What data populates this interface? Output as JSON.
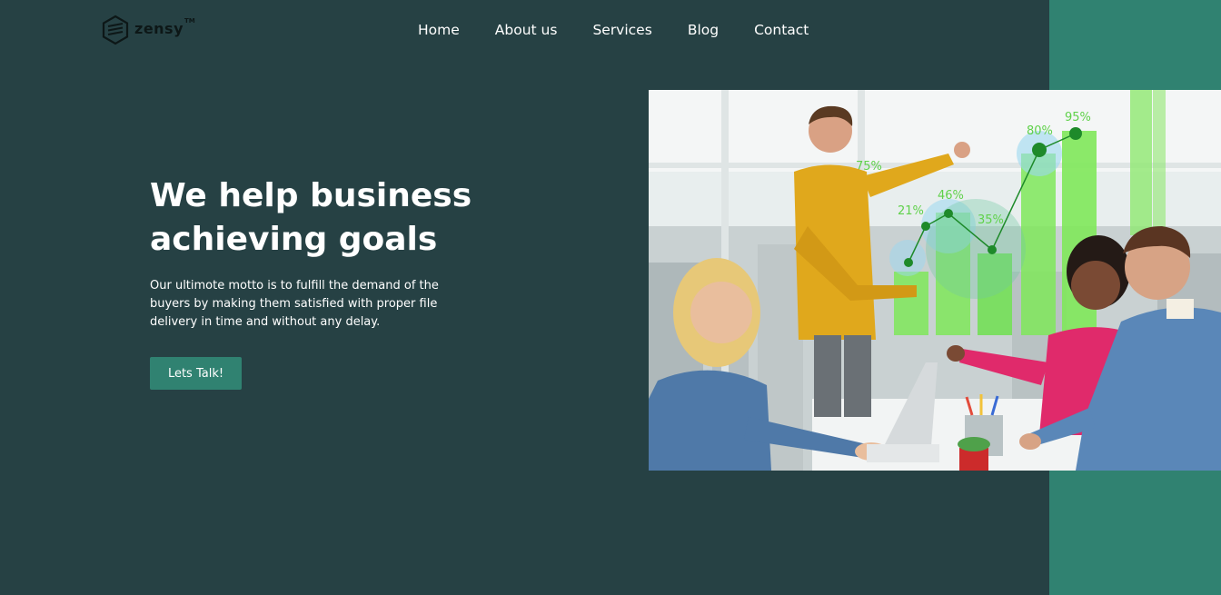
{
  "brand": {
    "name": "zensy",
    "trademark": "TM",
    "icon": "cube-logo-icon"
  },
  "nav": {
    "items": [
      {
        "label": "Home"
      },
      {
        "label": "About us"
      },
      {
        "label": "Services"
      },
      {
        "label": "Blog"
      },
      {
        "label": "Contact"
      }
    ]
  },
  "hero": {
    "title_line1": "We help business",
    "title_line2": "achieving goals",
    "description": "Our ultimote motto is to fulfill the demand of the buyers by making them satisfied with proper file delivery in time and without any delay.",
    "cta_label": "Lets Talk!"
  },
  "image": {
    "description_icon": "team-presentation-photo",
    "chart_labels": [
      "75%",
      "21%",
      "46%",
      "35%",
      "80%",
      "95%"
    ]
  },
  "colors": {
    "background": "#264144",
    "accent": "#308271",
    "chart_green": "#7fe85a"
  }
}
